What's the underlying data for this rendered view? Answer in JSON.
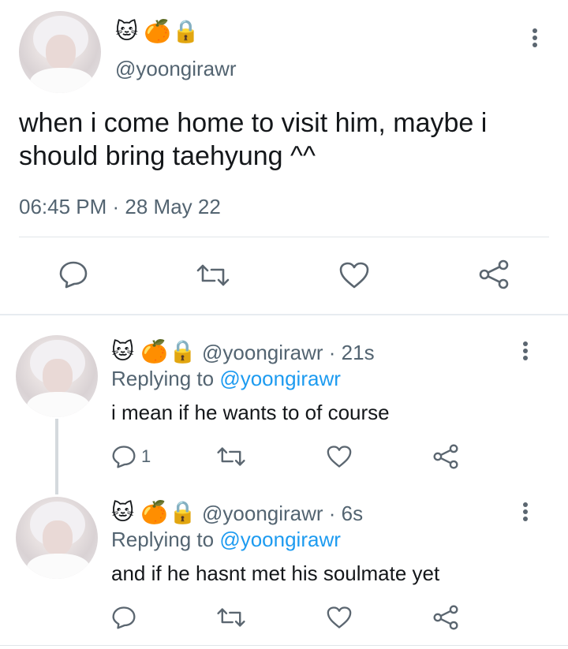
{
  "main_tweet": {
    "emojis": [
      "🐱",
      "🍊",
      "🔒"
    ],
    "handle": "@yoongirawr",
    "text_line1": "when i come home to visit him, maybe i",
    "text_line2": "should bring taehyung ^^",
    "timestamp": "06:45 PM · 28 May 22",
    "actions": [
      "reply-icon",
      "retweet-icon",
      "like-icon",
      "share-icon"
    ]
  },
  "replies": [
    {
      "emojis": [
        "🐱",
        "🍊",
        "🔒"
      ],
      "handle": "@yoongirawr",
      "time": "· 21s",
      "replying_prefix": "Replying to ",
      "replying_handle": "@yoongirawr",
      "text": "i mean if he wants to of course",
      "reply_count": "1"
    },
    {
      "emojis": [
        "🐱",
        "🍊",
        "🔒"
      ],
      "handle": "@yoongirawr",
      "time": "· 6s",
      "replying_prefix": "Replying to ",
      "replying_handle": "@yoongirawr",
      "text": "and if he hasnt met his soulmate yet",
      "reply_count": ""
    }
  ],
  "colors": {
    "link": "#1d9bf0",
    "secondary_text": "#536471",
    "icon": "#5b6670",
    "divider": "#e1e6ea"
  }
}
